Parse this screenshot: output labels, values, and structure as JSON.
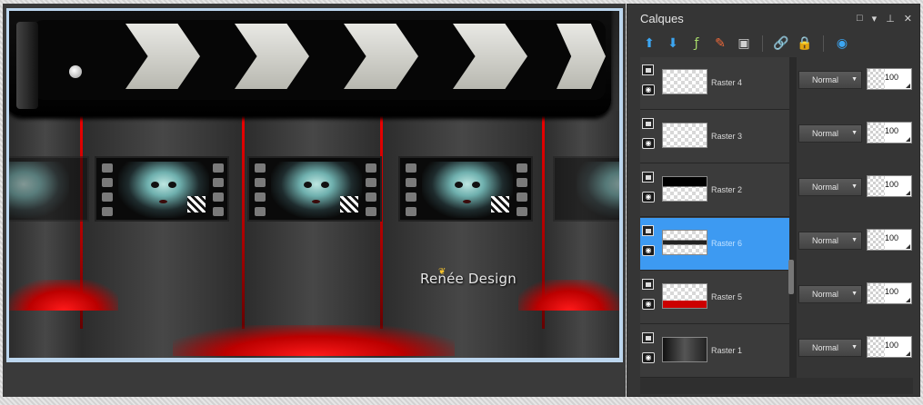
{
  "panel": {
    "title": "Calques",
    "controls": [
      "maximize-icon",
      "menu-arrow-icon",
      "pin-icon",
      "close-icon"
    ]
  },
  "toolbar": {
    "tools": [
      {
        "icon": "new-raster-layer-icon",
        "glyph": "⬆"
      },
      {
        "icon": "new-vector-layer-icon",
        "glyph": "⬇"
      },
      {
        "icon": "new-adjustment-layer-icon",
        "glyph": "ƒ"
      },
      {
        "icon": "new-mask-icon",
        "glyph": "✎"
      },
      {
        "icon": "delete-layer-icon",
        "glyph": "▣"
      },
      {
        "icon": "link-icon",
        "glyph": "🔗"
      },
      {
        "icon": "lock-icon",
        "glyph": "🔒"
      },
      {
        "icon": "visibility-toggle-icon",
        "glyph": "◉"
      }
    ]
  },
  "layers": [
    {
      "name": "Raster 4",
      "blend_mode": "Normal",
      "opacity": "100",
      "thumb": "transparent",
      "selected": false
    },
    {
      "name": "Raster 3",
      "blend_mode": "Normal",
      "opacity": "100",
      "thumb": "transparent",
      "selected": false
    },
    {
      "name": "Raster 2",
      "blend_mode": "Normal",
      "opacity": "100",
      "thumb": "black-top",
      "selected": false
    },
    {
      "name": "Raster 6",
      "blend_mode": "Normal",
      "opacity": "100",
      "thumb": "film-strip",
      "selected": true
    },
    {
      "name": "Raster 5",
      "blend_mode": "Normal",
      "opacity": "100",
      "thumb": "red-floor",
      "selected": false
    },
    {
      "name": "Raster 1",
      "blend_mode": "Normal",
      "opacity": "100",
      "thumb": "dark",
      "selected": false
    }
  ],
  "canvas": {
    "signature": "Renée Design"
  },
  "colors": {
    "selection": "#3d9af2",
    "panel_bg": "#353535",
    "accent_red": "#e00000"
  }
}
